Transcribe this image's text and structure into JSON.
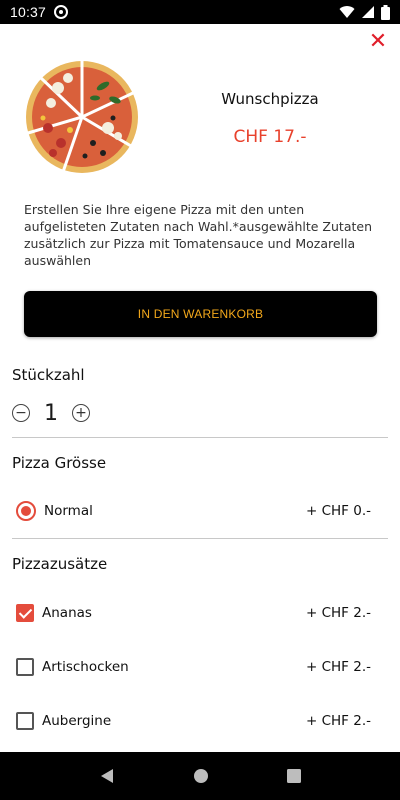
{
  "status_bar": {
    "time": "10:37",
    "icons": [
      "app-notification-icon",
      "wifi-icon",
      "signal-icon",
      "battery-icon"
    ]
  },
  "product": {
    "name": "Wunschpizza",
    "price": "CHF 17.-",
    "description": "Erstellen Sie Ihre eigene Pizza mit den unten aufgelisteten Zutaten nach Wahl.*ausgewählte Zutaten zusätzlich zur Pizza mit Tomatensauce und Mozarella auswählen",
    "image": "pizza-image"
  },
  "actions": {
    "add_to_cart": "IN DEN WARENKORB",
    "close_icon": "close-icon"
  },
  "quantity": {
    "title": "Stückzahl",
    "value": "1",
    "minus_icon": "minus-circle-icon",
    "plus_icon": "plus-circle-icon"
  },
  "size": {
    "title": "Pizza Grösse",
    "options": [
      {
        "label": "Normal",
        "price": "+ CHF 0.-",
        "selected": true
      }
    ]
  },
  "extras": {
    "title": "Pizzazusätze",
    "items": [
      {
        "label": "Ananas",
        "price": "+ CHF 2.-",
        "checked": true
      },
      {
        "label": "Artischocken",
        "price": "+ CHF 2.-",
        "checked": false
      },
      {
        "label": "Aubergine",
        "price": "+ CHF 2.-",
        "checked": false
      }
    ]
  },
  "colors": {
    "accent_red": "#e8412c",
    "button_text_orange": "#f3a81b",
    "close_red": "#e01e2a"
  },
  "nav_bar": {
    "icons": [
      "back-icon",
      "home-icon",
      "recents-icon"
    ]
  }
}
